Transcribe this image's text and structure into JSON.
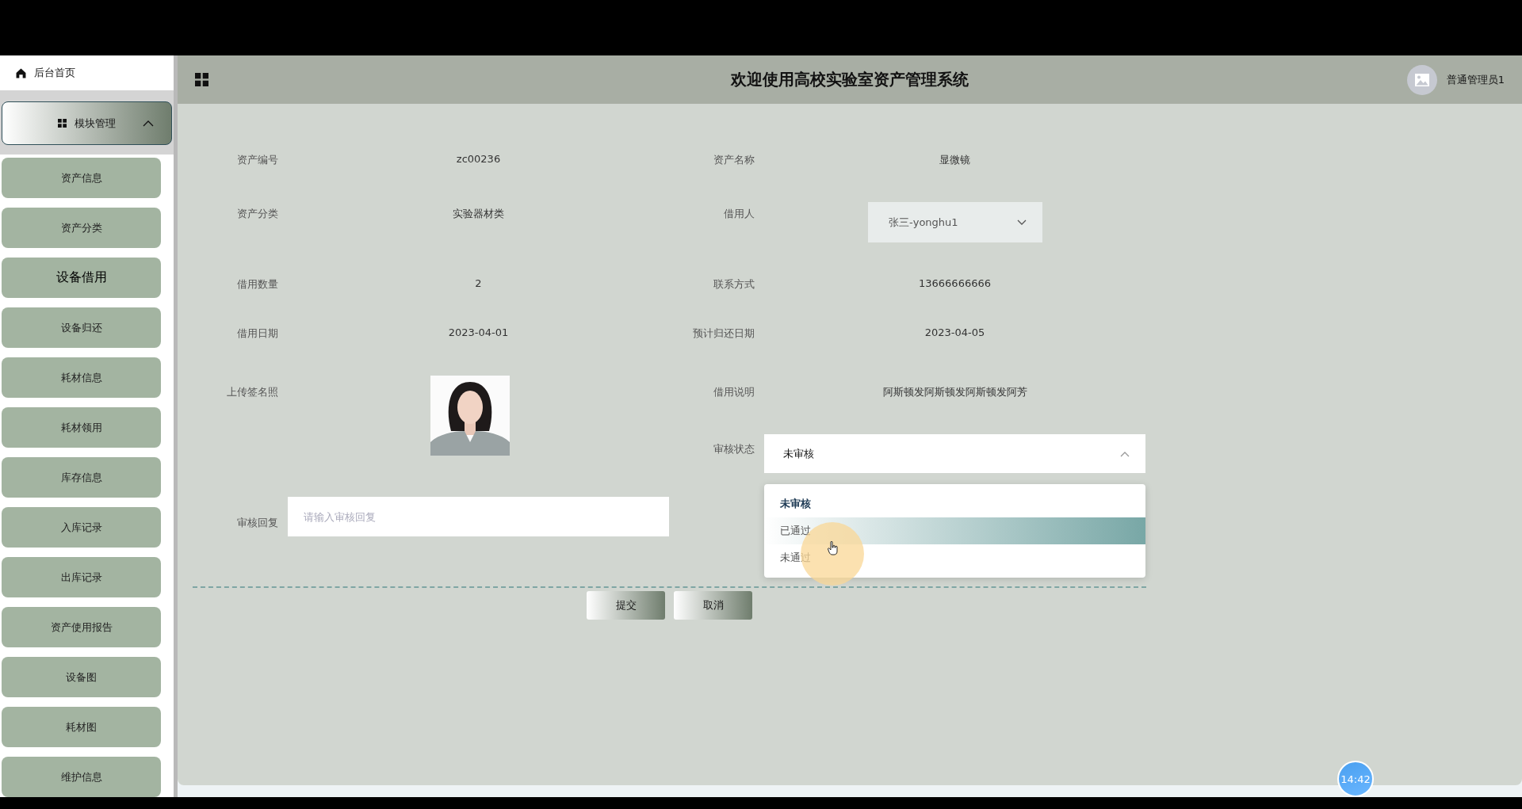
{
  "sidebar": {
    "home": {
      "label": "后台首页"
    },
    "group": {
      "label": "模块管理",
      "expanded": true
    },
    "items": [
      {
        "label": "资产信息",
        "selected": false
      },
      {
        "label": "资产分类",
        "selected": false
      },
      {
        "label": "设备借用",
        "selected": true
      },
      {
        "label": "设备归还",
        "selected": false
      },
      {
        "label": "耗材信息",
        "selected": false
      },
      {
        "label": "耗材领用",
        "selected": false
      },
      {
        "label": "库存信息",
        "selected": false
      },
      {
        "label": "入库记录",
        "selected": false
      },
      {
        "label": "出库记录",
        "selected": false
      },
      {
        "label": "资产使用报告",
        "selected": false
      },
      {
        "label": "设备图",
        "selected": false
      },
      {
        "label": "耗材图",
        "selected": false
      },
      {
        "label": "维护信息",
        "selected": false
      }
    ]
  },
  "header": {
    "title": "欢迎使用高校实验室资产管理系统",
    "user": "普通管理员1"
  },
  "form": {
    "asset_no": {
      "label": "资产编号",
      "value": "zc00236"
    },
    "asset_name": {
      "label": "资产名称",
      "value": "显微镜"
    },
    "category": {
      "label": "资产分类",
      "value": "实验器材类"
    },
    "borrower": {
      "label": "借用人",
      "value": "张三-yonghu1"
    },
    "quantity": {
      "label": "借用数量",
      "value": "2"
    },
    "contact": {
      "label": "联系方式",
      "value": "13666666666"
    },
    "borrow_date": {
      "label": "借用日期",
      "value": "2023-04-01"
    },
    "return_date": {
      "label": "预计归还日期",
      "value": "2023-04-05"
    },
    "photo": {
      "label": "上传签名照",
      "kind": "picture"
    },
    "note": {
      "label": "借用说明",
      "value": "阿斯顿发阿斯顿发阿斯顿发阿芳"
    },
    "status": {
      "label": "审核状态",
      "value": "未审核",
      "open": true,
      "options": [
        {
          "label": "未审核",
          "selected": true,
          "hovered": false
        },
        {
          "label": "已通过",
          "selected": false,
          "hovered": true
        },
        {
          "label": "未通过",
          "selected": false,
          "hovered": false
        }
      ]
    },
    "reply": {
      "label": "审核回复",
      "placeholder": "请输入审核回复"
    }
  },
  "buttons": [
    "提交",
    "取消"
  ],
  "clock": "14:42"
}
